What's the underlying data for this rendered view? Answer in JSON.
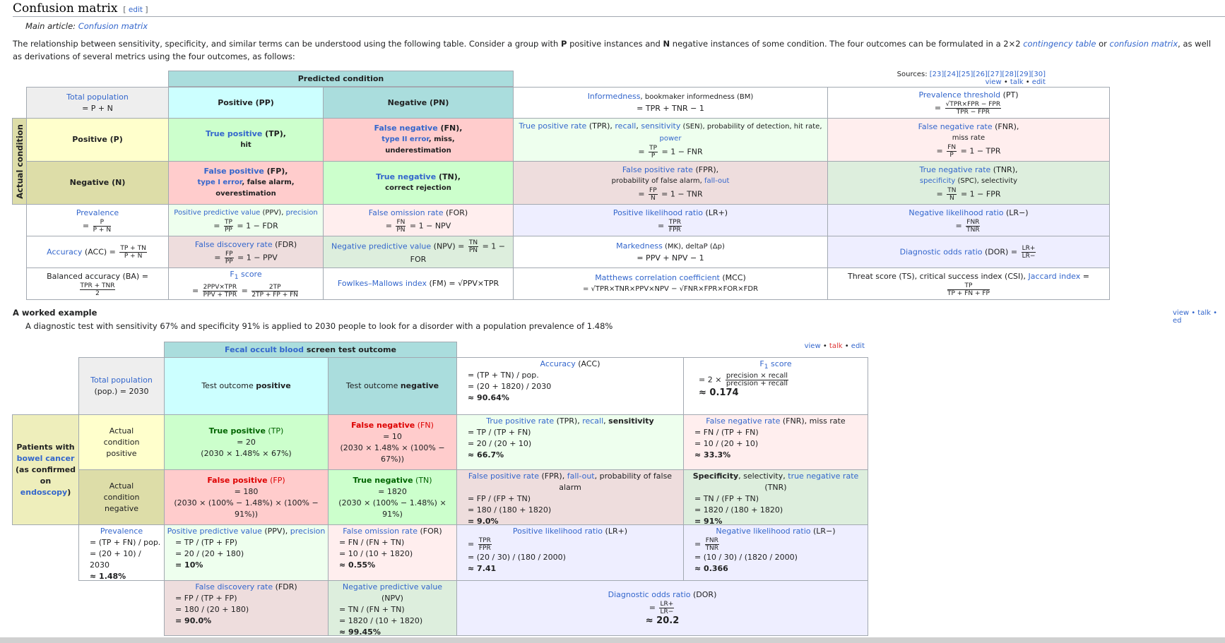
{
  "header": {
    "title": "Confusion matrix",
    "edit": "edit"
  },
  "hatnote": {
    "prefix": "Main article: ",
    "link": "Confusion matrix"
  },
  "intro": {
    "p1": "The relationship between sensitivity, specificity, and similar terms can be understood using the following table. Consider a group with ",
    "P": "P",
    "p2": " positive instances and ",
    "N": "N",
    "p3": " negative instances of some condition. The four outcomes can be formulated in a 2×2 ",
    "link1": "contingency table",
    "p4": " or ",
    "link2": "confusion matrix",
    "p5": ", as well as derivations of several metrics using the four outcomes, as follows:"
  },
  "sources": {
    "label": "Sources: ",
    "refs": "[23][24][25][26][27][28][29][30]",
    "view": "view",
    "talk": "talk",
    "edit": "edit"
  },
  "t1": {
    "predicted": "Predicted condition",
    "actual": "Actual condition",
    "totalpop": "Total population",
    "totalpop_f": "= P + N",
    "ppos": "Positive (PP)",
    "pneg": "Negative (PN)",
    "bm_link": "Informedness",
    "bm_txt": ", bookmaker informedness (BM)",
    "bm_f": "= TPR + TNR − 1",
    "pt_link": "Prevalence threshold",
    "pt_txt": " (PT)",
    "pt_num": "√TPR×FPR − FPR",
    "pt_den": "TPR − FPR",
    "apos": "Positive (P)",
    "aneg": "Negative (N)",
    "tp_link": "True positive",
    "tp_txt": " (TP),",
    "tp_sub": "hit",
    "fn_link": "False negative",
    "fn_txt": " (FN),",
    "fn_sub_link": "type II error",
    "fn_sub": ", miss,",
    "fn_sub2": "underestimation",
    "tpr_l1": "True positive rate",
    "tpr_t1": " (TPR), ",
    "tpr_l2": "recall",
    "tpr_t2": ", ",
    "tpr_l3": "sensitivity",
    "tpr_t3": " (SEN), probability of detection, hit rate, ",
    "tpr_l4": "power",
    "tpr_f": "= 1 − FNR",
    "tp": "TP",
    "p": "P",
    "fnr_link": "False negative rate",
    "fnr_txt": " (FNR),",
    "fnr_sub": "miss rate",
    "fnr_f": "= 1 − TPR",
    "fn": "FN",
    "fp_link": "False positive",
    "fp_txt": " (FP),",
    "fp_sub_link": "type I error",
    "fp_sub": ", false alarm,",
    "fp_sub2": "overestimation",
    "tn_link": "True negative",
    "tn_txt": " (TN),",
    "tn_sub": "correct rejection",
    "fpr_link": "False positive rate",
    "fpr_txt": " (FPR),",
    "fpr_sub": "probability of false alarm, ",
    "fpr_sub_link": "fall-out",
    "fpr_f": "= 1 − TNR",
    "fp": "FP",
    "n": "N",
    "tnr_link": "True negative rate",
    "tnr_txt": " (TNR),",
    "tnr_sub_link": "specificity",
    "tnr_sub": " (SPC), selectivity",
    "tnr_f": "= 1 − FPR",
    "tn": "TN",
    "prev_link": "Prevalence",
    "prev_num": "P",
    "prev_den": "P + N",
    "ppv_link": "Positive predictive value",
    "ppv_txt": " (PPV), ",
    "ppv_link2": "precision",
    "ppv_f": "= 1 − FDR",
    "pp": "PP",
    "for_link": "False omission rate",
    "for_txt": " (FOR)",
    "for_f": "= 1 − NPV",
    "pn": "PN",
    "lrp_link": "Positive likelihood ratio",
    "lrp_txt": " (LR+)",
    "tpr": "TPR",
    "fpr": "FPR",
    "lrn_link": "Negative likelihood ratio",
    "lrn_txt": " (LR−)",
    "fnr": "FNR",
    "tnr": "TNR",
    "acc_link": "Accuracy",
    "acc_txt": " (ACC) = ",
    "acc_num": "TP + TN",
    "acc_den": "P + N",
    "fdr_link": "False discovery rate",
    "fdr_txt": " (FDR)",
    "fdr_f": "= 1 − PPV",
    "npv_link": "Negative predictive value",
    "npv_txt": " (NPV) = ",
    "npv_f": "= 1 − FOR",
    "mk_link": "Markedness",
    "mk_txt": " (MK), deltaP (Δp)",
    "mk_f": "= PPV + NPV − 1",
    "dor_link": "Diagnostic odds ratio",
    "dor_txt": " (DOR) = ",
    "lrplus": "LR+",
    "lrminus": "LR−",
    "ba_txt": "Balanced accuracy (BA) = ",
    "ba_num": "TPR + TNR",
    "ba_den": "2",
    "f1_link": "F",
    "f1_sub": "1",
    "f1_txt": " score",
    "f1_num1": "2PPV×TPR",
    "f1_den1": "PPV + TPR",
    "f1_num2": "2TP",
    "f1_den2": "2TP + FP + FN",
    "fm_link": "Fowlkes–Mallows index",
    "fm_txt": " (FM) = √PPV×TPR",
    "mcc_link": "Matthews correlation coefficient",
    "mcc_txt": " (MCC)",
    "mcc_f": "= √TPR×TNR×PPV×NPV − √FNR×FPR×FOR×FDR",
    "ts_txt": "Threat score (TS), critical success index (CSI), ",
    "ts_link": "Jaccard index",
    "ts_eq": " = ",
    "ts_num": "TP",
    "ts_den": "TP + FN + FP"
  },
  "worked": {
    "title": "A worked example",
    "desc": "A diagnostic test with sensitivity 67% and specificity 91% is applied to 2030 people to look for a disorder with a population prevalence of 1.48%",
    "view": "view",
    "talk": "talk",
    "edit": "edit",
    "nav_r": "view • talk • ed"
  },
  "t2": {
    "head_link1": "Fecal occult blood",
    "head_txt": " screen test outcome",
    "tp_link": "Total population",
    "tp_txt": "(pop.) = 2030",
    "outpos_a": "Test outcome ",
    "outpos_b": "positive",
    "outneg_a": "Test outcome ",
    "outneg_b": "negative",
    "acc_link": "Accuracy",
    "acc_txt": " (ACC)",
    "acc_l1": "= (TP + TN) / pop.",
    "acc_l2": "= (20 + 1820) / 2030",
    "acc_l3": "≈ 90.64%",
    "f1_link": "F",
    "f1_sub": "1",
    "f1_txt": " score",
    "f1_pre": "= 2 × ",
    "f1_num": "precision × recall",
    "f1_den": "precision + recall",
    "f1_res": "≈ 0.174",
    "pat_a": "Patients with",
    "pat_link": "bowel cancer",
    "pat_b": "(as confirmed",
    "pat_c": "on ",
    "pat_link2": "endoscopy",
    "pat_d": ")",
    "acp": "Actual condition positive",
    "acn": "Actual condition negative",
    "tp_l": "True positive",
    "tp_t": " (TP)",
    "tp_v": "= 20",
    "tp_c": "(2030 × 1.48% × 67%)",
    "fn_l": "False negative",
    "fn_t": " (FN)",
    "fn_v": "= 10",
    "fn_c": "(2030 × 1.48% × (100% − 67%))",
    "tpr_l1": "True positive rate",
    "tpr_t1": " (TPR), ",
    "tpr_l2": "recall",
    "tpr_t2": ", ",
    "tpr_b": "sensitivity",
    "tpr_1": "= TP / (TP + FN)",
    "tpr_2": "= 20 / (20 + 10)",
    "tpr_3": "≈ 66.7%",
    "fnr_l": "False negative rate",
    "fnr_t": " (FNR), miss rate",
    "fnr_1": "= FN / (TP + FN)",
    "fnr_2": "= 10 / (20 + 10)",
    "fnr_3": "≈ 33.3%",
    "fp_l": "False positive",
    "fp_t": " (FP)",
    "fp_v": "= 180",
    "fp_c": "(2030 × (100% − 1.48%) × (100% − 91%))",
    "tn_l": "True negative",
    "tn_t": " (TN)",
    "tn_v": "= 1820",
    "tn_c": "(2030 × (100% − 1.48%) × 91%)",
    "fpr_l": "False positive rate",
    "fpr_t": " (FPR), ",
    "fpr_l2": "fall-out",
    "fpr_t2": ", probability of false alarm",
    "fpr_1": "= FP / (FP + TN)",
    "fpr_2": "= 180 / (180 + 1820)",
    "fpr_3": "= 9.0%",
    "spc_b": "Specificity",
    "spc_t": ", selectivity, ",
    "spc_l": "true negative rate",
    "spc_t2": " (TNR)",
    "spc_1": "= TN / (FP + TN)",
    "spc_2": "= 1820 / (180 + 1820)",
    "spc_3": "= 91%",
    "prev_l": "Prevalence",
    "prev_1": "= (TP + FN) / pop.",
    "prev_2": "= (20 + 10) / 2030",
    "prev_3": "≈ 1.48%",
    "ppv_l": "Positive predictive value",
    "ppv_t": " (PPV), ",
    "ppv_l2": "precision",
    "ppv_1": "= TP / (TP + FP)",
    "ppv_2": "= 20 / (20 + 180)",
    "ppv_3": "= 10%",
    "for_l": "False omission rate",
    "for_t": " (FOR)",
    "for_1": "= FN / (FN + TN)",
    "for_2": "= 10 / (10 + 1820)",
    "for_3": "≈ 0.55%",
    "lrp_l": "Positive likelihood ratio",
    "lrp_t": " (LR+)",
    "lrp_num": "TPR",
    "lrp_den": "FPR",
    "lrp_2": "= (20 / 30) / (180 / 2000)",
    "lrp_3": "≈ 7.41",
    "lrn_l": "Negative likelihood ratio",
    "lrn_t": " (LR−)",
    "lrn_num": "FNR",
    "lrn_den": "TNR",
    "lrn_2": "= (10 / 30) / (1820 / 2000)",
    "lrn_3": "≈ 0.366",
    "fdr_l": "False discovery rate",
    "fdr_t": " (FDR)",
    "fdr_1": "= FP / (TP + FP)",
    "fdr_2": "= 180 / (20 + 180)",
    "fdr_3": "= 90.0%",
    "npv_l": "Negative predictive value",
    "npv_t": " (NPV)",
    "npv_1": "= TN / (FN + TN)",
    "npv_2": "= 1820 / (10 + 1820)",
    "npv_3": "≈ 99.45%",
    "dor_l": "Diagnostic odds ratio",
    "dor_t": " (DOR)",
    "dor_num": "LR+",
    "dor_den": "LR−",
    "dor_3": "≈ 20.2"
  }
}
